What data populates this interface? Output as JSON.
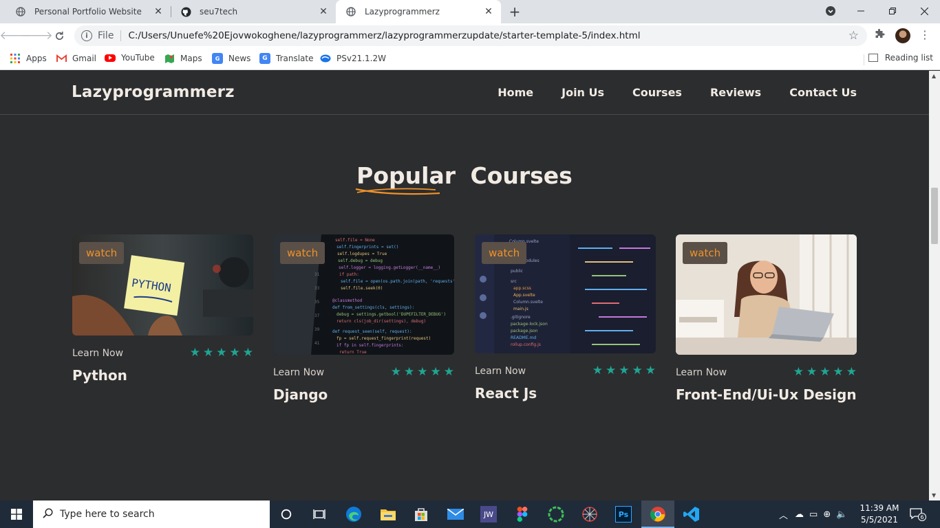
{
  "browser": {
    "tabs": [
      {
        "title": "Personal Portfolio Website",
        "icon": "globe-icon",
        "active": false
      },
      {
        "title": "seu7tech",
        "icon": "github-icon",
        "active": false
      },
      {
        "title": "Lazyprogrammerz",
        "icon": "globe-icon",
        "active": true
      }
    ],
    "new_tab": "+",
    "address": {
      "scheme": "File",
      "url": "C:/Users/Unuefe%20Ejovwokoghene/lazyprogrammerz/lazyprogrammerzupdate/starter-template-5/index.html"
    },
    "bookmarks": [
      {
        "label": "Apps",
        "icon": "apps-grid-icon"
      },
      {
        "label": "Gmail",
        "icon": "gmail-icon"
      },
      {
        "label": "YouTube",
        "icon": "youtube-icon"
      },
      {
        "label": "Maps",
        "icon": "maps-icon"
      },
      {
        "label": "News",
        "icon": "news-icon"
      },
      {
        "label": "Translate",
        "icon": "translate-icon"
      },
      {
        "label": "PSv21.1.2W",
        "icon": "psv-icon"
      }
    ],
    "reading_list": "Reading list"
  },
  "site": {
    "brand": "Lazyprogrammerz",
    "nav": [
      "Home",
      "Join Us",
      "Courses",
      "Reviews",
      "Contact Us"
    ],
    "section_title_highlight": "Popular",
    "section_title_rest": "Courses",
    "courses": [
      {
        "name": "Python",
        "watch": "watch",
        "learn": "Learn Now",
        "rating": 5,
        "image": "python-sticky-note"
      },
      {
        "name": "Django",
        "watch": "watch",
        "learn": "Learn Now",
        "rating": 5,
        "image": "code-screen"
      },
      {
        "name": "React Js",
        "watch": "watch",
        "learn": "Learn Now",
        "rating": 5,
        "image": "editor-screen"
      },
      {
        "name": "Front-End/Ui-Ux Design",
        "watch": "watch",
        "learn": "Learn Now",
        "rating": 5,
        "image": "woman-laptop"
      }
    ]
  },
  "taskbar": {
    "search_placeholder": "Type here to search",
    "apps": [
      "cortana-icon",
      "task-view-icon",
      "edge-icon",
      "file-explorer-icon",
      "store-icon",
      "mail-icon",
      "jw-icon",
      "figma-icon",
      "ring-app-icon",
      "spider-icon",
      "photoshop-icon",
      "chrome-icon",
      "vscode-icon"
    ],
    "time": "11:39 AM",
    "date": "5/5/2021",
    "notification_count": "6"
  },
  "colors": {
    "page_bg": "#2c2d2f",
    "accent_orange": "#f0922a",
    "star_teal": "#1fa593",
    "text_light": "#f1ebe4"
  }
}
